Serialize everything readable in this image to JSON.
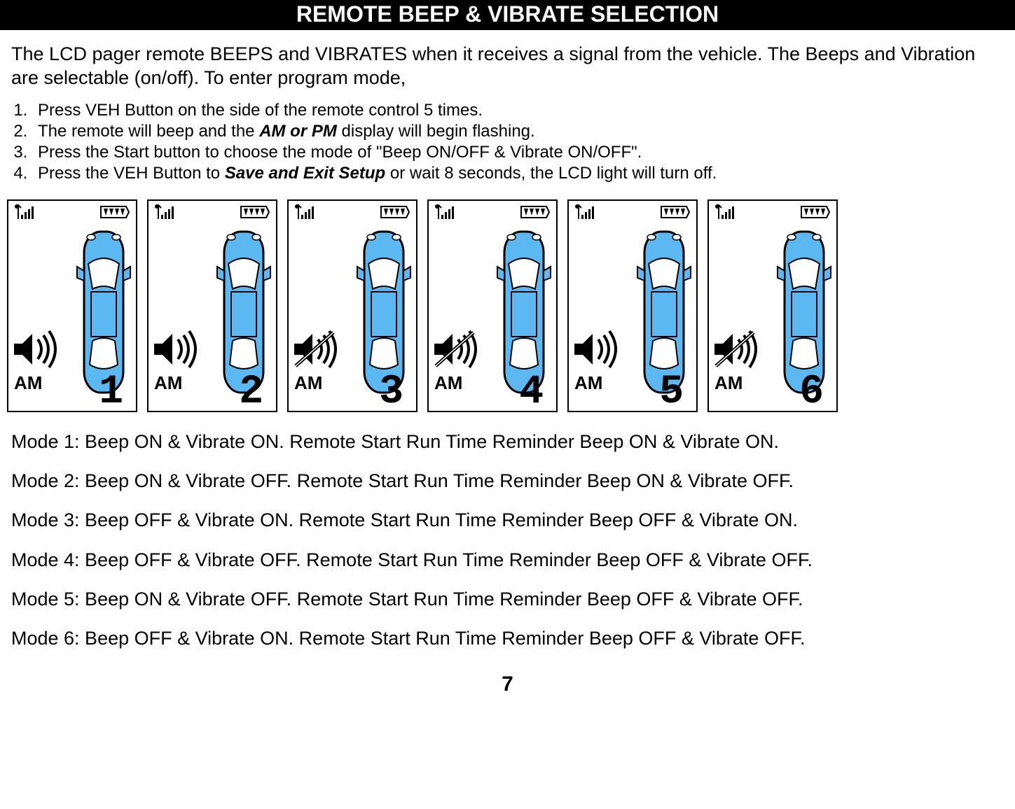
{
  "header": {
    "title": "REMOTE BEEP & VIBRATE SELECTION"
  },
  "intro": {
    "text_a": "The LCD pager remote BEEPS and VIBRATES when it receives a signal from the vehicle. The Beeps and Vibration are selectable (on/off). To enter program mode,"
  },
  "steps": [
    {
      "pre": "Press VEH Button on the side of the remote control 5 times."
    },
    {
      "pre": "The remote will beep and the ",
      "em": "AM or PM",
      "post": " display will begin flashing."
    },
    {
      "pre": "Press the Start button to choose the mode of  \"Beep ON/OFF & Vibrate ON/OFF\"."
    },
    {
      "pre": "Press the VEH Button to ",
      "em": "Save and Exit Setup",
      "post": " or wait 8 seconds, the LCD light will turn off."
    }
  ],
  "lcd_panels": [
    {
      "digit": "1",
      "am": "AM",
      "speaker": "on-sound"
    },
    {
      "digit": "2",
      "am": "AM",
      "speaker": "on-sound"
    },
    {
      "digit": "3",
      "am": "AM",
      "speaker": "off-sound"
    },
    {
      "digit": "4",
      "am": "AM",
      "speaker": "off-sound"
    },
    {
      "digit": "5",
      "am": "AM",
      "speaker": "on-sound"
    },
    {
      "digit": "6",
      "am": "AM",
      "speaker": "off-sound"
    }
  ],
  "modes": [
    "Mode 1: Beep ON & Vibrate ON.  Remote Start Run Time Reminder Beep ON & Vibrate ON.",
    "Mode 2: Beep ON & Vibrate OFF. Remote Start Run Time Reminder Beep ON & Vibrate OFF.",
    "Mode 3: Beep OFF & Vibrate ON. Remote Start Run Time Reminder Beep OFF & Vibrate ON.",
    "Mode 4: Beep OFF & Vibrate OFF. Remote Start Run Time Reminder Beep OFF & Vibrate OFF.",
    "Mode 5: Beep ON & Vibrate OFF. Remote Start Run Time Reminder Beep OFF & Vibrate OFF.",
    "Mode 6: Beep OFF & Vibrate ON. Remote Start Run Time Reminder Beep OFF & Vibrate OFF."
  ],
  "page_number": "7"
}
